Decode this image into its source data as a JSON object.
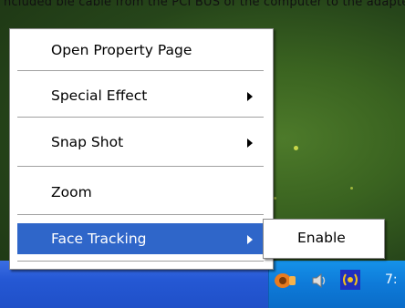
{
  "background_text": "ncluded ble cable from the PCI BUS of the computer to the adapter.",
  "context_menu": {
    "items": [
      {
        "label": "Open Property Page",
        "has_submenu": false
      },
      {
        "label": "Special Effect",
        "has_submenu": true
      },
      {
        "label": "Snap Shot",
        "has_submenu": true
      },
      {
        "label": "Zoom",
        "has_submenu": false
      },
      {
        "label": "Face Tracking",
        "has_submenu": true,
        "highlighted": true
      }
    ],
    "highlight_color": "#2f66c9"
  },
  "submenu": {
    "items": [
      {
        "label": "Enable"
      }
    ]
  },
  "taskbar": {
    "tray_icons": [
      "camera-app-icon",
      "speaker-icon",
      "wireless-network-icon"
    ],
    "clock": "7:"
  }
}
